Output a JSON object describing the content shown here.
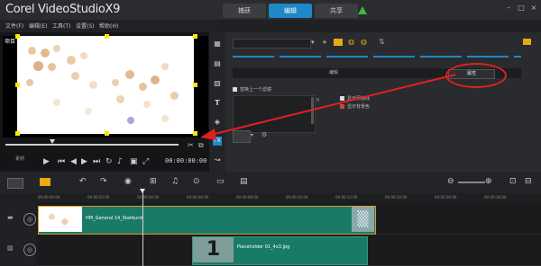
{
  "app": {
    "title": "Corel VideoStudioX9"
  },
  "steps": [
    {
      "label": "捕获",
      "active": false
    },
    {
      "label": "编辑",
      "active": true
    },
    {
      "label": "共享",
      "active": false
    }
  ],
  "menu": [
    "文件(F)",
    "编辑(E)",
    "工具(T)",
    "设置(S)",
    "帮助(H)"
  ],
  "player": {
    "project_label": "项目",
    "timecode": "00:00:00:00",
    "mode_label": "素材"
  },
  "options": {
    "selector_value": "",
    "tabs": [
      "编辑",
      "属性"
    ],
    "active_tab": "属性",
    "checkbox_apply_all": "替换上一个滤镜",
    "checkbox_show_grid": "显示网格线",
    "checkbox_bg": "显示背景色"
  },
  "timeline": {
    "ruler_ticks": [
      "00:00:00:00",
      "00:00:02:00",
      "00:00:04:00",
      "00:00:06:00",
      "00:00:08:00",
      "00:00:10:00",
      "00:00:12:00",
      "00:00:14:00",
      "00:00:16:00",
      "00:00:18:00"
    ],
    "video_clip_name": "HM_General 14_Starburst",
    "overlay_clip_name": "Placeholder 01_4x3.jpg",
    "overlay_number": "1"
  },
  "colors": {
    "accent": "#1e88c8",
    "clip": "#1a7a68",
    "annotation": "#e02020"
  }
}
